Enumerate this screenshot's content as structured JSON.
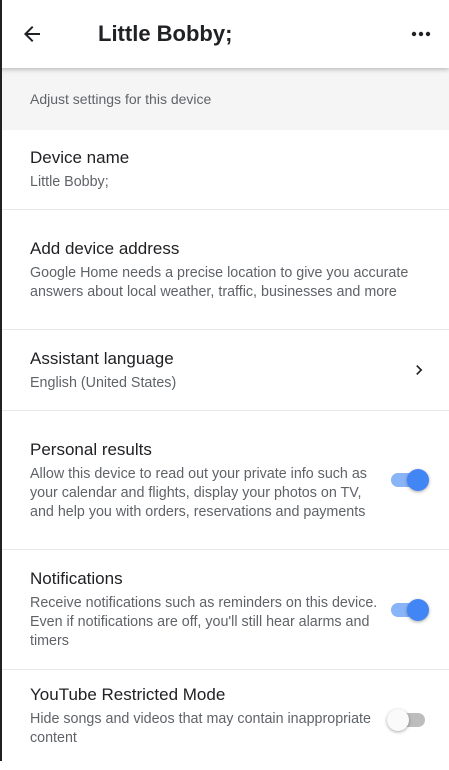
{
  "header": {
    "title": "Little Bobby;",
    "back_icon": "arrow-left-icon",
    "more_icon": "more-horizontal-icon"
  },
  "subheader": "Adjust settings for this device",
  "settings": [
    {
      "title": "Device name",
      "description": "Little Bobby;"
    },
    {
      "title": "Add device address",
      "description": "Google Home needs a precise location to give you accurate answers about local weather, traffic, businesses and more"
    },
    {
      "title": "Assistant language",
      "description": "English (United States)",
      "action": "chevron-right-icon"
    },
    {
      "title": "Personal results",
      "description": "Allow this device to read out your private info such as your calendar and flights, display your photos on TV, and help you with orders, reservations and payments",
      "toggle_on": true
    },
    {
      "title": "Notifications",
      "description": "Receive notifications such as reminders on this device. Even if notifications are off, you'll still hear alarms and timers",
      "toggle_on": true
    },
    {
      "title": "YouTube Restricted Mode",
      "description": "Hide songs and videos that may contain inappropriate content",
      "toggle_on": false
    }
  ],
  "colors": {
    "accent": "#4285f4",
    "accent_track": "#8ab4f8",
    "subheader_bg": "#f5f5f5"
  }
}
